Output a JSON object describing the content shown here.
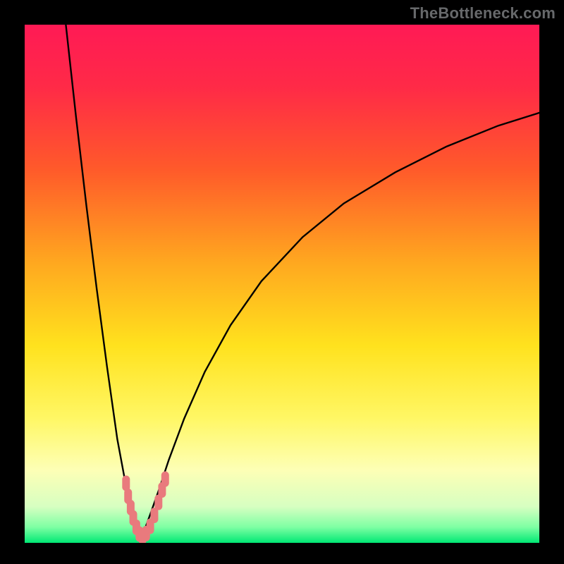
{
  "watermark": "TheBottleneck.com",
  "colors": {
    "frame": "#000000",
    "gradient_stops": [
      {
        "pct": 0,
        "color": "#ff1a55"
      },
      {
        "pct": 12,
        "color": "#ff2a47"
      },
      {
        "pct": 28,
        "color": "#ff5a2a"
      },
      {
        "pct": 46,
        "color": "#ffa81f"
      },
      {
        "pct": 62,
        "color": "#ffe21e"
      },
      {
        "pct": 76,
        "color": "#fff765"
      },
      {
        "pct": 86,
        "color": "#fdffb6"
      },
      {
        "pct": 93,
        "color": "#d7ffc1"
      },
      {
        "pct": 97,
        "color": "#7dffa3"
      },
      {
        "pct": 100,
        "color": "#00e874"
      }
    ],
    "curve": "#000000",
    "markers": "#e97a7d"
  },
  "chart_data": {
    "type": "line",
    "title": "",
    "xlabel": "",
    "ylabel": "",
    "xlim": [
      0,
      100
    ],
    "ylim": [
      0,
      100
    ],
    "series": [
      {
        "name": "bottleneck-curve-left",
        "x": [
          8,
          10,
          12,
          14,
          16,
          18,
          19.5,
          20.5,
          21.3,
          22.0,
          22.6
        ],
        "y": [
          100,
          82,
          65,
          49,
          34,
          20,
          12,
          7.5,
          4.5,
          2.5,
          1.3
        ]
      },
      {
        "name": "bottleneck-curve-right",
        "x": [
          22.6,
          23.4,
          24.4,
          26,
          28,
          31,
          35,
          40,
          46,
          54,
          62,
          72,
          82,
          92,
          100
        ],
        "y": [
          1.3,
          2.8,
          5.5,
          10,
          16,
          24,
          33,
          42,
          50.5,
          59,
          65.5,
          71.5,
          76.5,
          80.5,
          83
        ]
      }
    ],
    "markers": {
      "name": "valley-markers",
      "points": [
        {
          "x": 19.7,
          "y": 11.5
        },
        {
          "x": 20.1,
          "y": 9.0
        },
        {
          "x": 20.6,
          "y": 6.8
        },
        {
          "x": 21.1,
          "y": 4.8
        },
        {
          "x": 21.7,
          "y": 3.0
        },
        {
          "x": 22.3,
          "y": 1.7
        },
        {
          "x": 22.9,
          "y": 1.2
        },
        {
          "x": 23.6,
          "y": 1.8
        },
        {
          "x": 24.4,
          "y": 3.2
        },
        {
          "x": 25.2,
          "y": 5.3
        },
        {
          "x": 26.0,
          "y": 7.8
        },
        {
          "x": 26.7,
          "y": 10.2
        },
        {
          "x": 27.3,
          "y": 12.3
        }
      ]
    },
    "minimum": {
      "x": 22.9,
      "y_bottleneck_pct": 1.2
    }
  }
}
